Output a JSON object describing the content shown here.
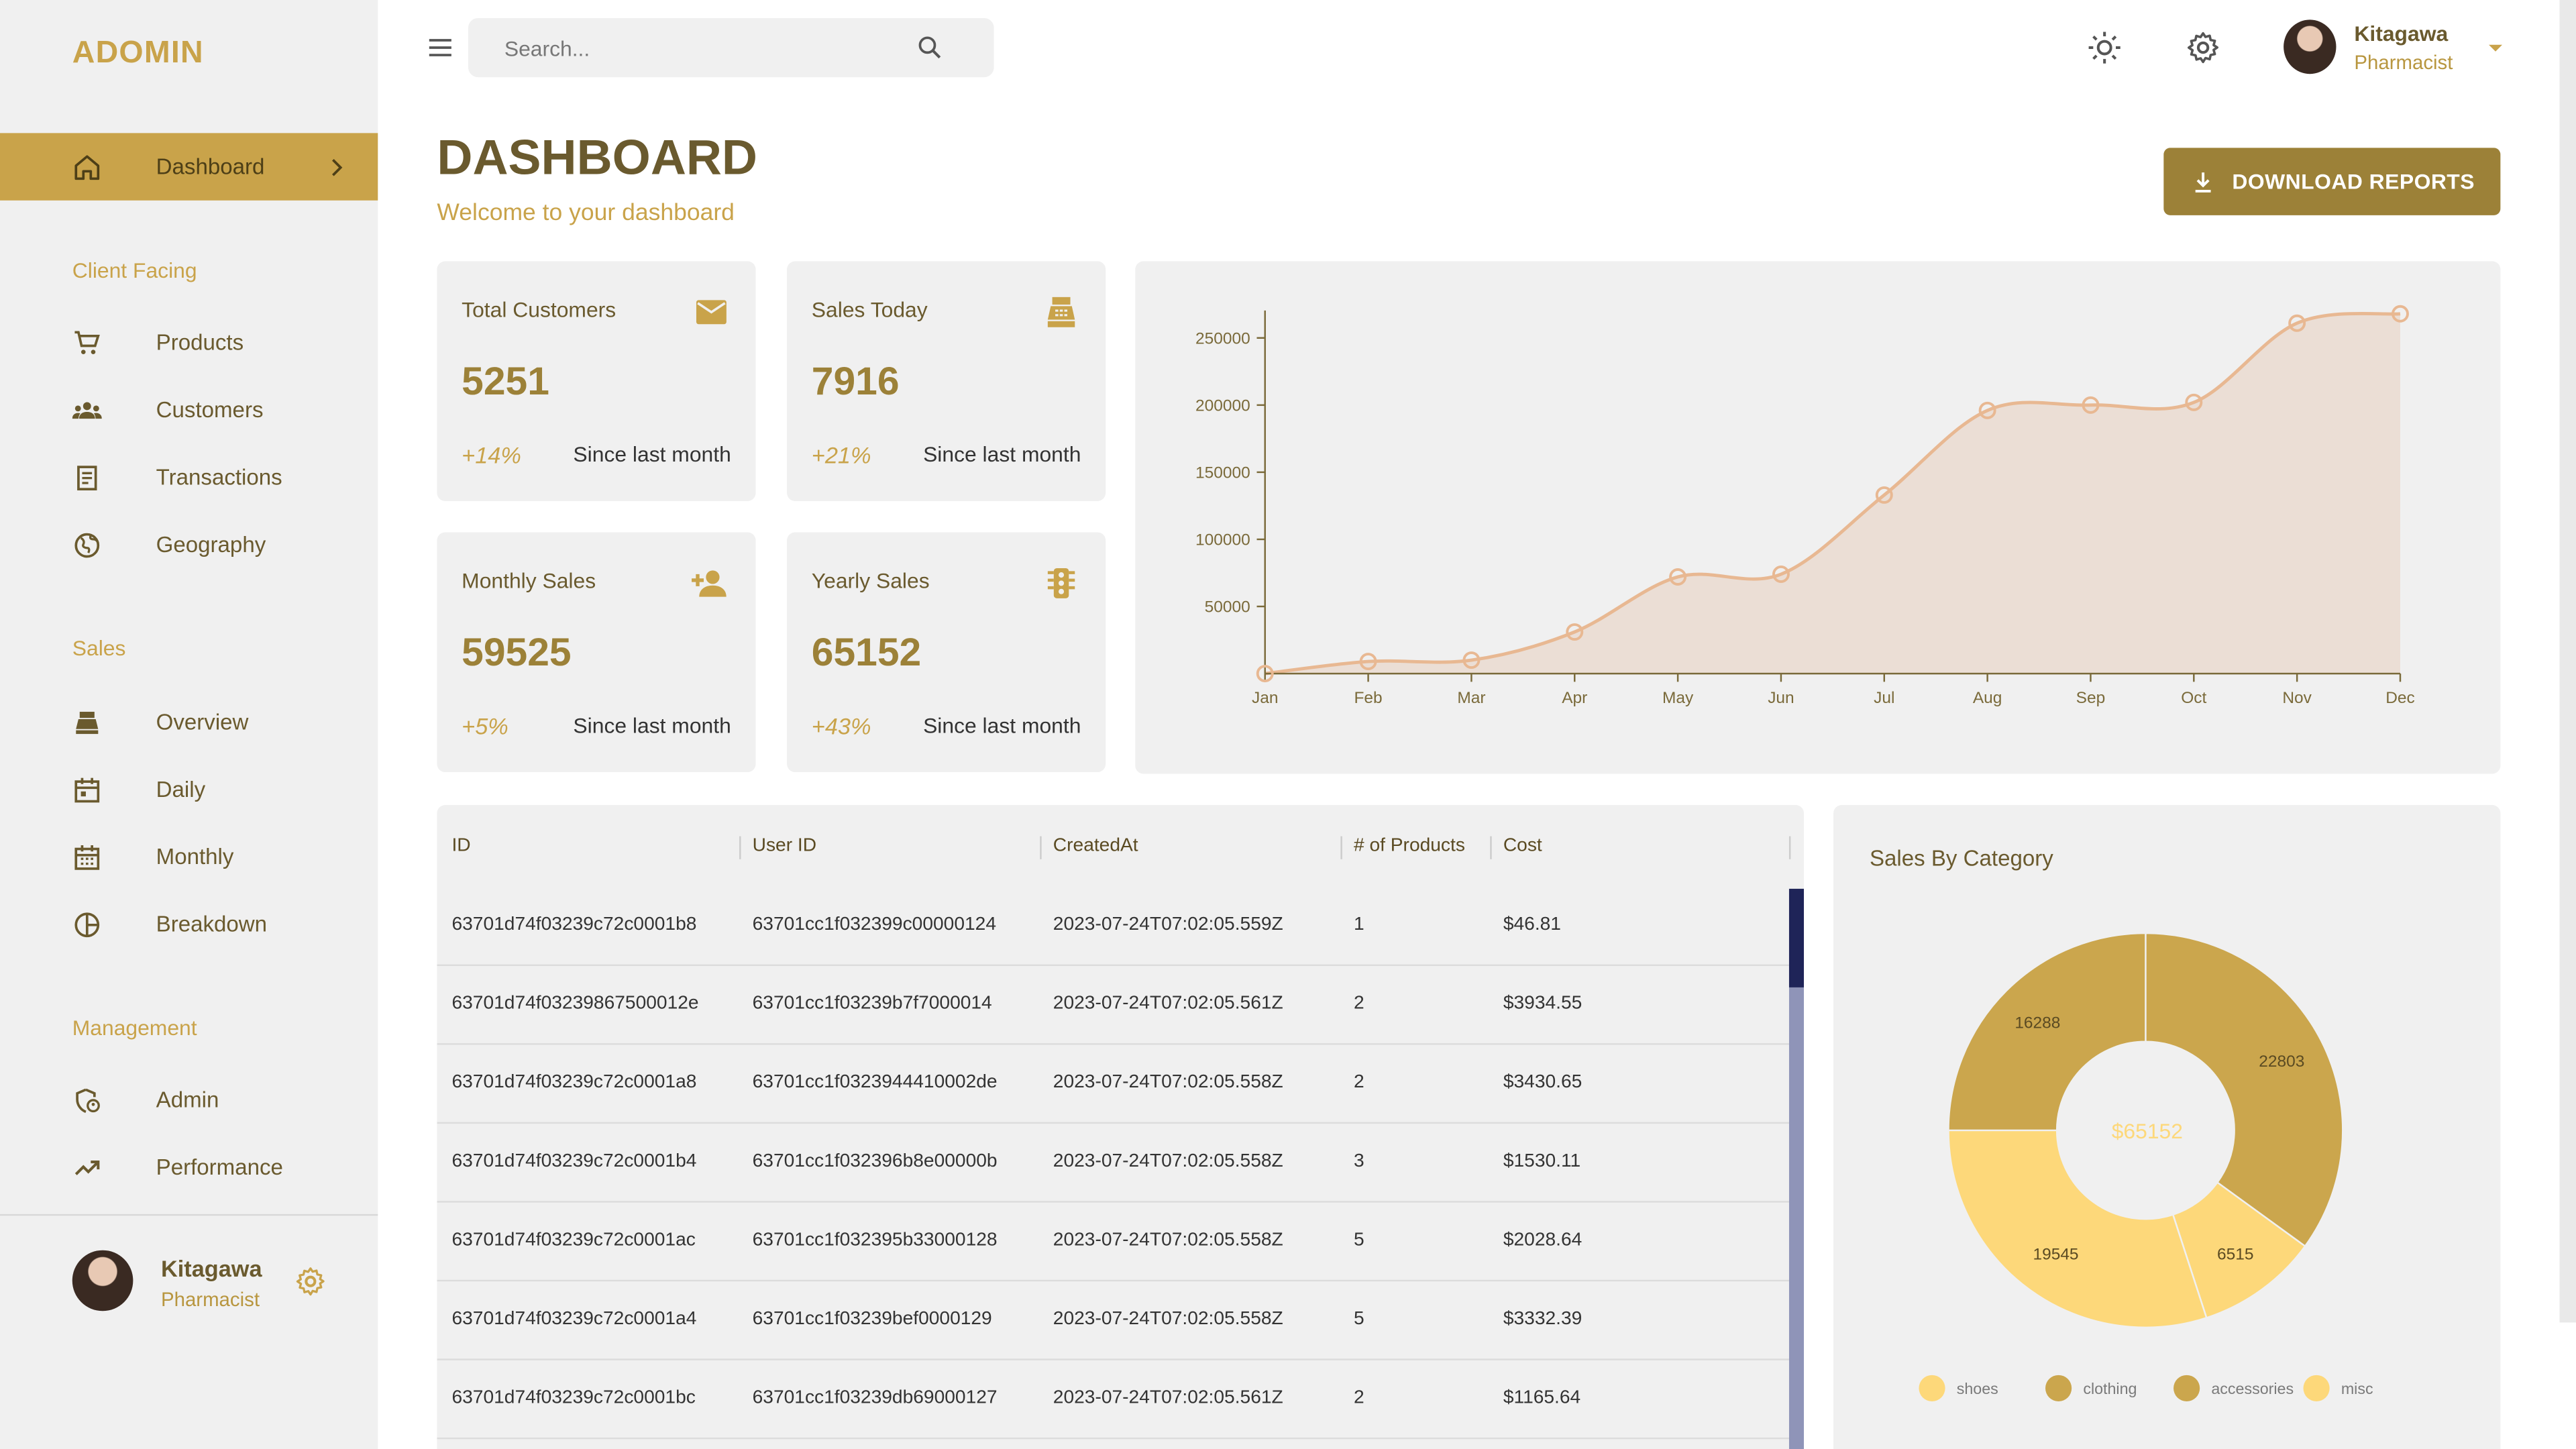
{
  "brand": "ADOMIN",
  "sidebar": {
    "dashboard": "Dashboard",
    "sections": [
      "Client Facing",
      "Sales",
      "Management"
    ],
    "client_facing": [
      {
        "label": "Products",
        "icon": "cart-icon"
      },
      {
        "label": "Customers",
        "icon": "groups-icon"
      },
      {
        "label": "Transactions",
        "icon": "receipt-icon"
      },
      {
        "label": "Geography",
        "icon": "globe-icon"
      }
    ],
    "sales": [
      {
        "label": "Overview",
        "icon": "point-of-sale-icon"
      },
      {
        "label": "Daily",
        "icon": "calendar-day-icon"
      },
      {
        "label": "Monthly",
        "icon": "calendar-month-icon"
      },
      {
        "label": "Breakdown",
        "icon": "pie-chart-icon"
      }
    ],
    "management": [
      {
        "label": "Admin",
        "icon": "admin-icon"
      },
      {
        "label": "Performance",
        "icon": "trending-up-icon"
      }
    ],
    "profile": {
      "name": "Kitagawa",
      "role": "Pharmacist"
    }
  },
  "topbar": {
    "search_placeholder": "Search...",
    "profile": {
      "name": "Kitagawa",
      "role": "Pharmacist"
    }
  },
  "header": {
    "title": "DASHBOARD",
    "subtitle": "Welcome to your dashboard",
    "download_label": "DOWNLOAD REPORTS"
  },
  "stats": [
    {
      "title": "Total Customers",
      "value": "5251",
      "increase": "+14%",
      "since": "Since last month",
      "icon": "email-icon"
    },
    {
      "title": "Sales Today",
      "value": "7916",
      "increase": "+21%",
      "since": "Since last month",
      "icon": "point-of-sale-icon"
    },
    {
      "title": "Monthly Sales",
      "value": "59525",
      "increase": "+5%",
      "since": "Since last month",
      "icon": "person-add-icon"
    },
    {
      "title": "Yearly Sales",
      "value": "65152",
      "increase": "+43%",
      "since": "Since last month",
      "icon": "traffic-icon"
    }
  ],
  "table": {
    "columns": [
      "ID",
      "User ID",
      "CreatedAt",
      "# of Products",
      "Cost"
    ],
    "rows": [
      [
        "63701d74f03239c72c0001b8",
        "63701cc1f032399c00000124",
        "2023-07-24T07:02:05.559Z",
        "1",
        "$46.81"
      ],
      [
        "63701d74f03239867500012e",
        "63701cc1f03239b7f7000014",
        "2023-07-24T07:02:05.561Z",
        "2",
        "$3934.55"
      ],
      [
        "63701d74f03239c72c0001a8",
        "63701cc1f0323944410002de",
        "2023-07-24T07:02:05.558Z",
        "2",
        "$3430.65"
      ],
      [
        "63701d74f03239c72c0001b4",
        "63701cc1f032396b8e00000b",
        "2023-07-24T07:02:05.558Z",
        "3",
        "$1530.11"
      ],
      [
        "63701d74f03239c72c0001ac",
        "63701cc1f032395b33000128",
        "2023-07-24T07:02:05.558Z",
        "5",
        "$2028.64"
      ],
      [
        "63701d74f03239c72c0001a4",
        "63701cc1f03239bef0000129",
        "2023-07-24T07:02:05.558Z",
        "5",
        "$3332.39"
      ],
      [
        "63701d74f03239c72c0001bc",
        "63701cc1f03239db69000127",
        "2023-07-24T07:02:05.561Z",
        "2",
        "$1165.64"
      ]
    ]
  },
  "colors": {
    "accent": "#c9a34a",
    "accent_dark": "#9c8138",
    "text_dark": "#6a5a2e",
    "line": "#e8b892",
    "pie_light": "#fdd87a",
    "pie_dark": "#cba64d"
  },
  "chart_data": [
    {
      "type": "area",
      "categories": [
        "Jan",
        "Feb",
        "Mar",
        "Apr",
        "May",
        "Jun",
        "Jul",
        "Aug",
        "Sep",
        "Oct",
        "Nov",
        "Dec"
      ],
      "values": [
        0,
        9000,
        10000,
        31000,
        72000,
        74000,
        133000,
        196000,
        200000,
        202000,
        261000,
        268000
      ],
      "yticks": [
        "50000",
        "100000",
        "150000",
        "200000",
        "250000"
      ],
      "ylim": [
        0,
        268000
      ],
      "grid": false
    },
    {
      "type": "pie",
      "title": "Sales By Category",
      "center_label": "$65152",
      "slices": [
        {
          "label": "clothing",
          "value": 22803
        },
        {
          "label": "accessories",
          "value": 19545
        },
        {
          "label": "shoes",
          "value": 16288
        },
        {
          "label": "misc",
          "value": 6515
        }
      ],
      "slice_order": [
        "clothing",
        "misc",
        "accessories",
        "shoes"
      ],
      "slice_values_ordered": [
        22803,
        19545,
        16288,
        6515
      ],
      "legend": [
        "shoes",
        "clothing",
        "accessories",
        "misc"
      ],
      "legend_placement": "bottom"
    }
  ]
}
